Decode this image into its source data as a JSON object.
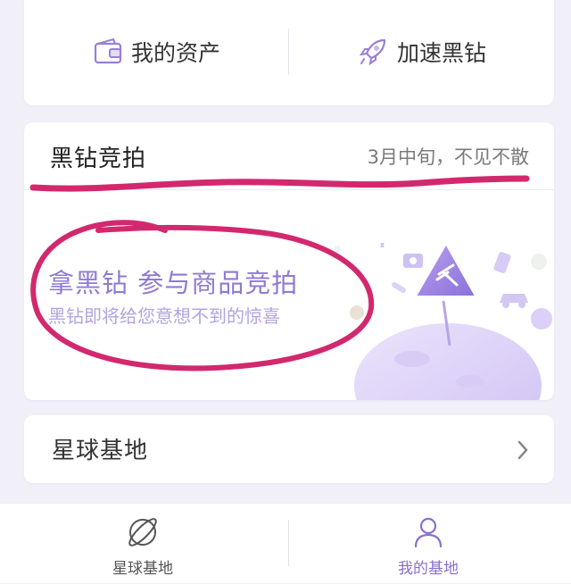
{
  "top_actions": {
    "assets_label": "我的资产",
    "accelerate_label": "加速黑钻"
  },
  "auction": {
    "title": "黑钻竞拍",
    "note": "3月中旬，不见不散",
    "promo_title": "拿黑钻 参与商品竞拍",
    "promo_subtitle": "黑钻即将给您意想不到的惊喜"
  },
  "base_row": {
    "title": "星球基地"
  },
  "tabbar": {
    "tabs": [
      {
        "label": "星球基地",
        "icon": "planet-icon",
        "active": false
      },
      {
        "label": "我的基地",
        "icon": "person-icon",
        "active": true
      }
    ]
  },
  "colors": {
    "accent": "#8a6fcf",
    "annotation": "#d2286e",
    "background": "#f1eff7"
  }
}
